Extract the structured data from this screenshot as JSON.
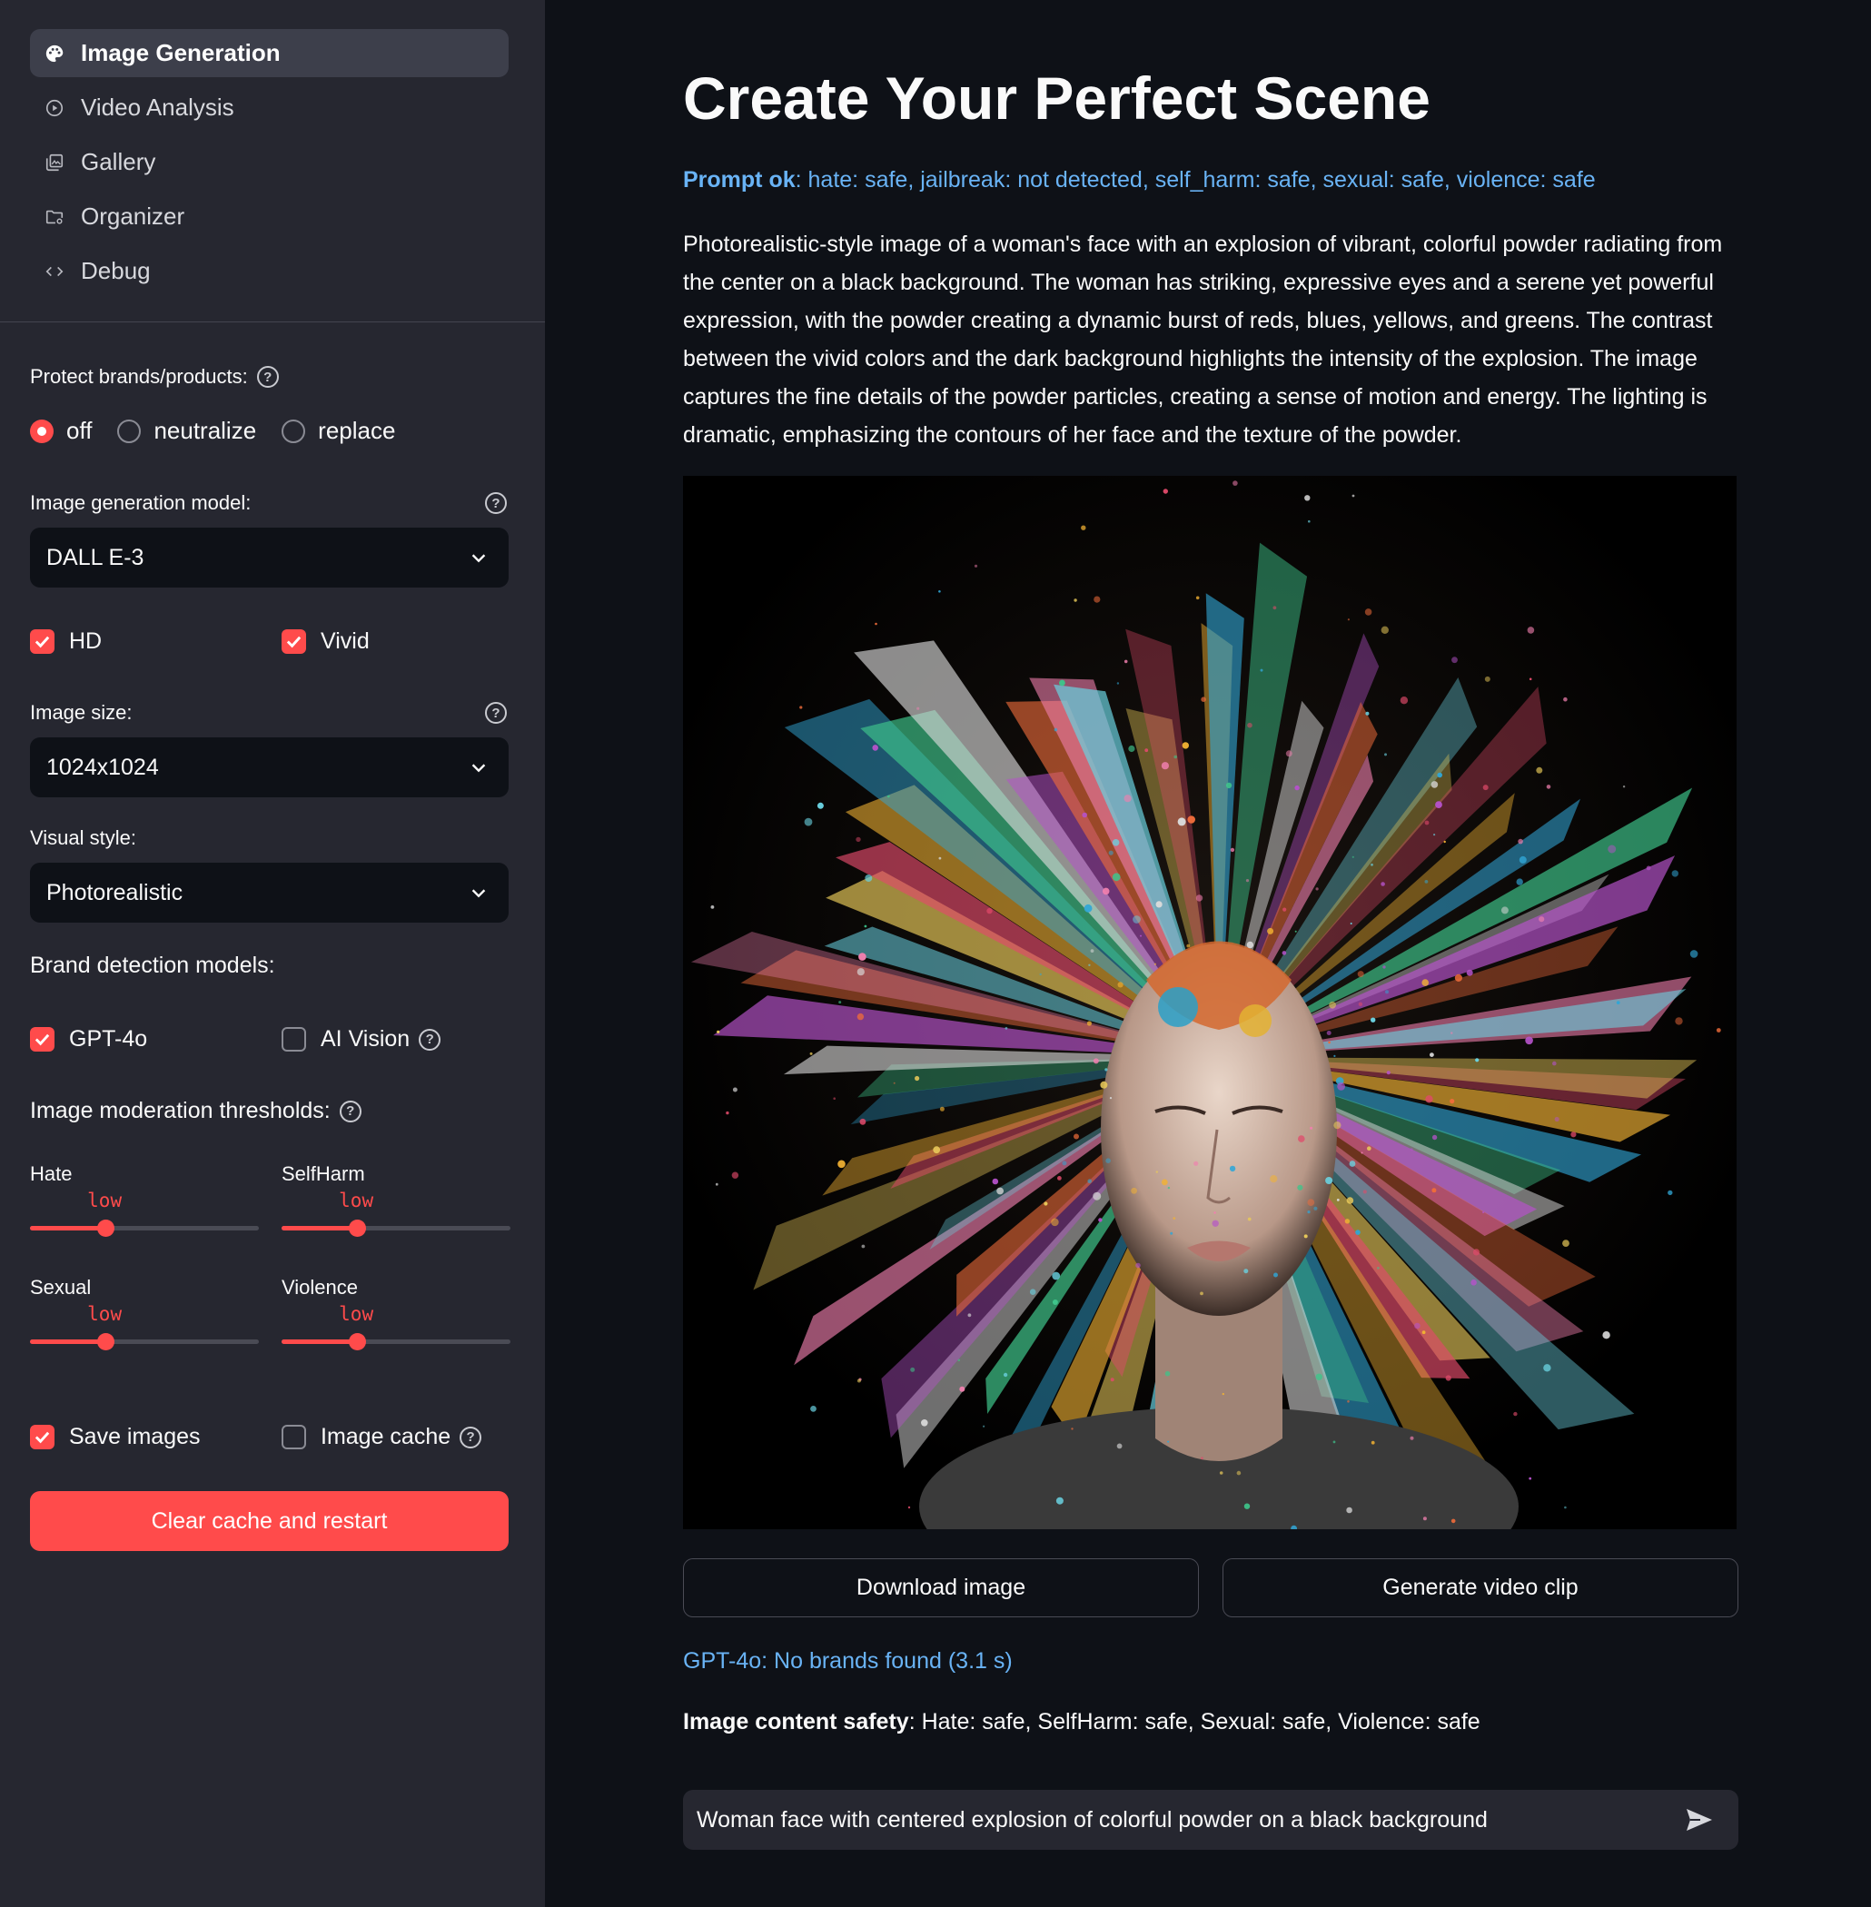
{
  "sidebar": {
    "nav": [
      {
        "label": "Image Generation",
        "icon": "palette-icon",
        "active": true
      },
      {
        "label": "Video Analysis",
        "icon": "play-circle-icon",
        "active": false
      },
      {
        "label": "Gallery",
        "icon": "gallery-icon",
        "active": false
      },
      {
        "label": "Organizer",
        "icon": "folder-settings-icon",
        "active": false
      },
      {
        "label": "Debug",
        "icon": "code-icon",
        "active": false
      }
    ],
    "protect_label": "Protect brands/products:",
    "protect_options": [
      "off",
      "neutralize",
      "replace"
    ],
    "protect_selected": "off",
    "model_label": "Image generation model:",
    "model_value": "DALL E-3",
    "hd_label": "HD",
    "vivid_label": "Vivid",
    "size_label": "Image size:",
    "size_value": "1024x1024",
    "style_label": "Visual style:",
    "style_value": "Photorealistic",
    "brand_detection_title": "Brand detection models:",
    "gpt4o_label": "GPT-4o",
    "aivision_label": "AI Vision",
    "moderation_title": "Image moderation thresholds:",
    "sliders": [
      {
        "name": "Hate",
        "value": "low",
        "level": 0.33
      },
      {
        "name": "SelfHarm",
        "value": "low",
        "level": 0.33
      },
      {
        "name": "Sexual",
        "value": "low",
        "level": 0.33
      },
      {
        "name": "Violence",
        "value": "low",
        "level": 0.33
      }
    ],
    "save_images_label": "Save images",
    "image_cache_label": "Image cache",
    "clear_button": "Clear cache and restart",
    "checkbox_states": {
      "hd": true,
      "vivid": true,
      "gpt4o": true,
      "aivision": false,
      "save_images": true,
      "image_cache": false
    }
  },
  "main": {
    "title": "Create Your Perfect Scene",
    "prompt_ok_label": "Prompt ok",
    "prompt_ok_text": ": hate: safe, jailbreak: not detected, self_harm: safe, sexual: safe, violence: safe",
    "description": "Photorealistic-style image of a woman's face with an explosion of vibrant, colorful powder radiating from the center on a black background. The woman has striking, expressive eyes and a serene yet powerful expression, with the powder creating a dynamic burst of reds, blues, yellows, and greens. The contrast between the vivid colors and the dark background highlights the intensity of the explosion. The image captures the fine details of the powder particles, creating a sense of motion and energy. The lighting is dramatic, emphasizing the contours of her face and the texture of the powder.",
    "download_button": "Download image",
    "video_button": "Generate video clip",
    "gpt_result": "GPT-4o: No brands found (3.1 s)",
    "safety_label": "Image content safety",
    "safety_text": ": Hate: safe, SelfHarm: safe, Sexual: safe, Violence: safe",
    "chat_value": "Woman face with centered explosion of colorful powder on a black background"
  },
  "colors": {
    "accent": "#ff4b4b",
    "link": "#69b3f5",
    "sidebar_bg": "#262730",
    "main_bg": "#0e1117"
  }
}
